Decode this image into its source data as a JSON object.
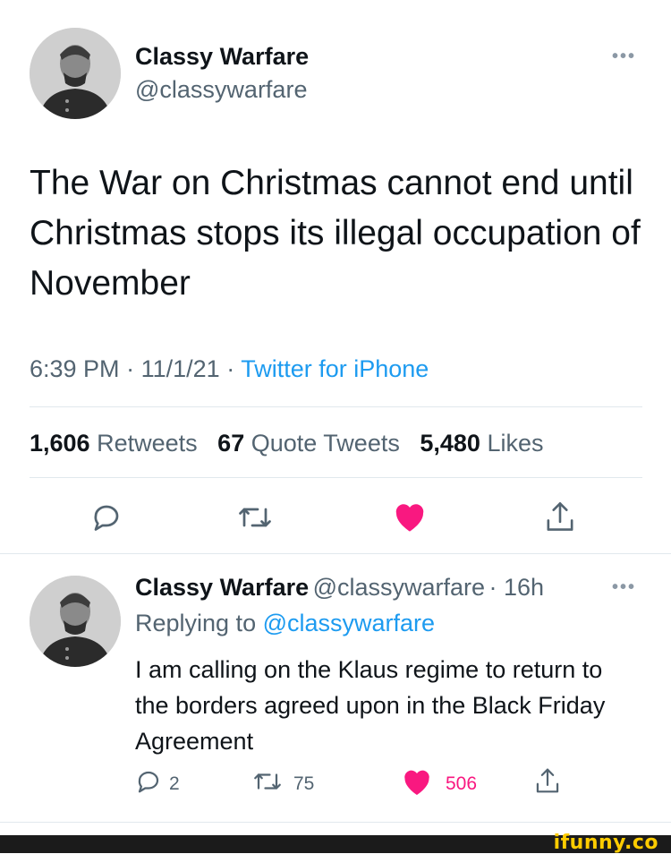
{
  "tweet": {
    "author_name": "Classy Warfare",
    "author_handle": "@classywarfare",
    "text": "The War on Christmas cannot end until Christmas stops its illegal occupation of November",
    "time": "6:39 PM",
    "date": "11/1/21",
    "source": "Twitter for iPhone",
    "separator": "·",
    "stats": {
      "retweets_count": "1,606",
      "retweets_label": "Retweets",
      "quotes_count": "67",
      "quotes_label": "Quote Tweets",
      "likes_count": "5,480",
      "likes_label": "Likes"
    }
  },
  "reply": {
    "author_name": "Classy Warfare",
    "author_handle": "@classywarfare",
    "age": "· 16h",
    "replying_to_label": "Replying to",
    "replying_to_handle": "@classywarfare",
    "text": "I am calling on the Klaus regime to return to the borders agreed upon in the Black Friday Agreement",
    "counts": {
      "replies": "2",
      "retweets": "75",
      "likes": "506"
    }
  },
  "more_menu": "•••",
  "watermark": "ifunny.co",
  "colors": {
    "accent": "#1d9bf0",
    "like": "#f91880",
    "muted": "#536471",
    "text": "#0f1419"
  },
  "icons": [
    "reply-icon",
    "retweet-icon",
    "like-icon",
    "share-icon"
  ]
}
